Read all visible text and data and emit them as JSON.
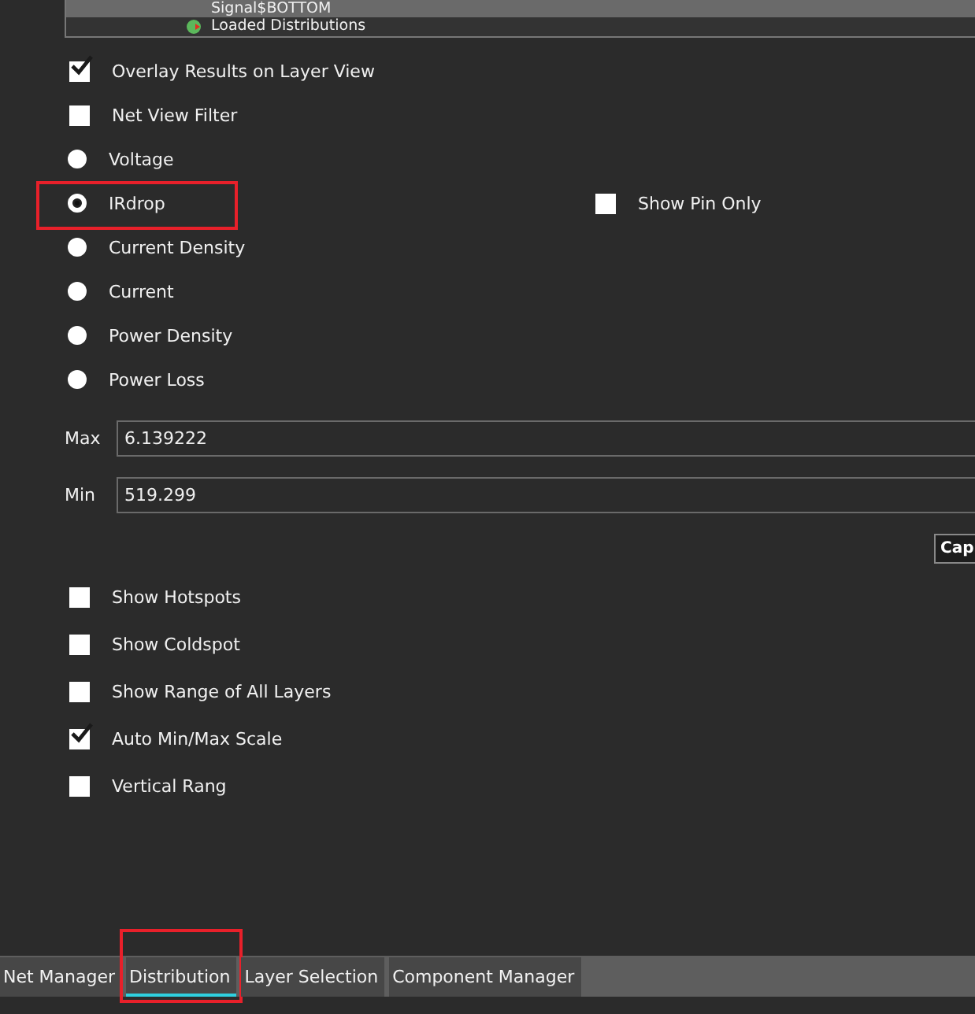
{
  "tree": {
    "items": [
      {
        "label": "Signal$BOTTOM",
        "selected": true
      },
      {
        "label": "Loaded Distributions",
        "selected": false
      }
    ]
  },
  "options": [
    {
      "kind": "checkbox",
      "label": "Overlay Results on Layer View",
      "checked": true
    },
    {
      "kind": "checkbox",
      "label": "Net View Filter",
      "checked": false
    },
    {
      "kind": "radio",
      "label": "Voltage",
      "selected": false
    },
    {
      "kind": "radio",
      "label": "IRdrop",
      "selected": true,
      "highlighted": true,
      "side": {
        "label": "Show Pin Only",
        "checked": false
      }
    },
    {
      "kind": "radio",
      "label": "Current Density",
      "selected": false
    },
    {
      "kind": "radio",
      "label": "Current",
      "selected": false
    },
    {
      "kind": "radio",
      "label": "Power Density",
      "selected": false
    },
    {
      "kind": "radio",
      "label": "Power Loss",
      "selected": false
    }
  ],
  "range": [
    {
      "label": "Max",
      "value": "6.139222"
    },
    {
      "label": "Min",
      "value": "519.299"
    }
  ],
  "button": "Cap",
  "display_options": [
    {
      "label": "Show Hotspots",
      "checked": false
    },
    {
      "label": "Show Coldspot",
      "checked": false
    },
    {
      "label": "Show Range of All Layers",
      "checked": false
    },
    {
      "label": "Auto Min/Max Scale",
      "checked": true
    },
    {
      "label": "Vertical Rang",
      "checked": false
    }
  ],
  "tabs": [
    {
      "label": "Net Manager",
      "selected": false,
      "highlighted": false
    },
    {
      "label": "Distribution",
      "selected": true,
      "highlighted": true
    },
    {
      "label": "Layer Selection",
      "selected": false,
      "highlighted": false
    },
    {
      "label": "Component Manager",
      "selected": false,
      "highlighted": false
    }
  ]
}
